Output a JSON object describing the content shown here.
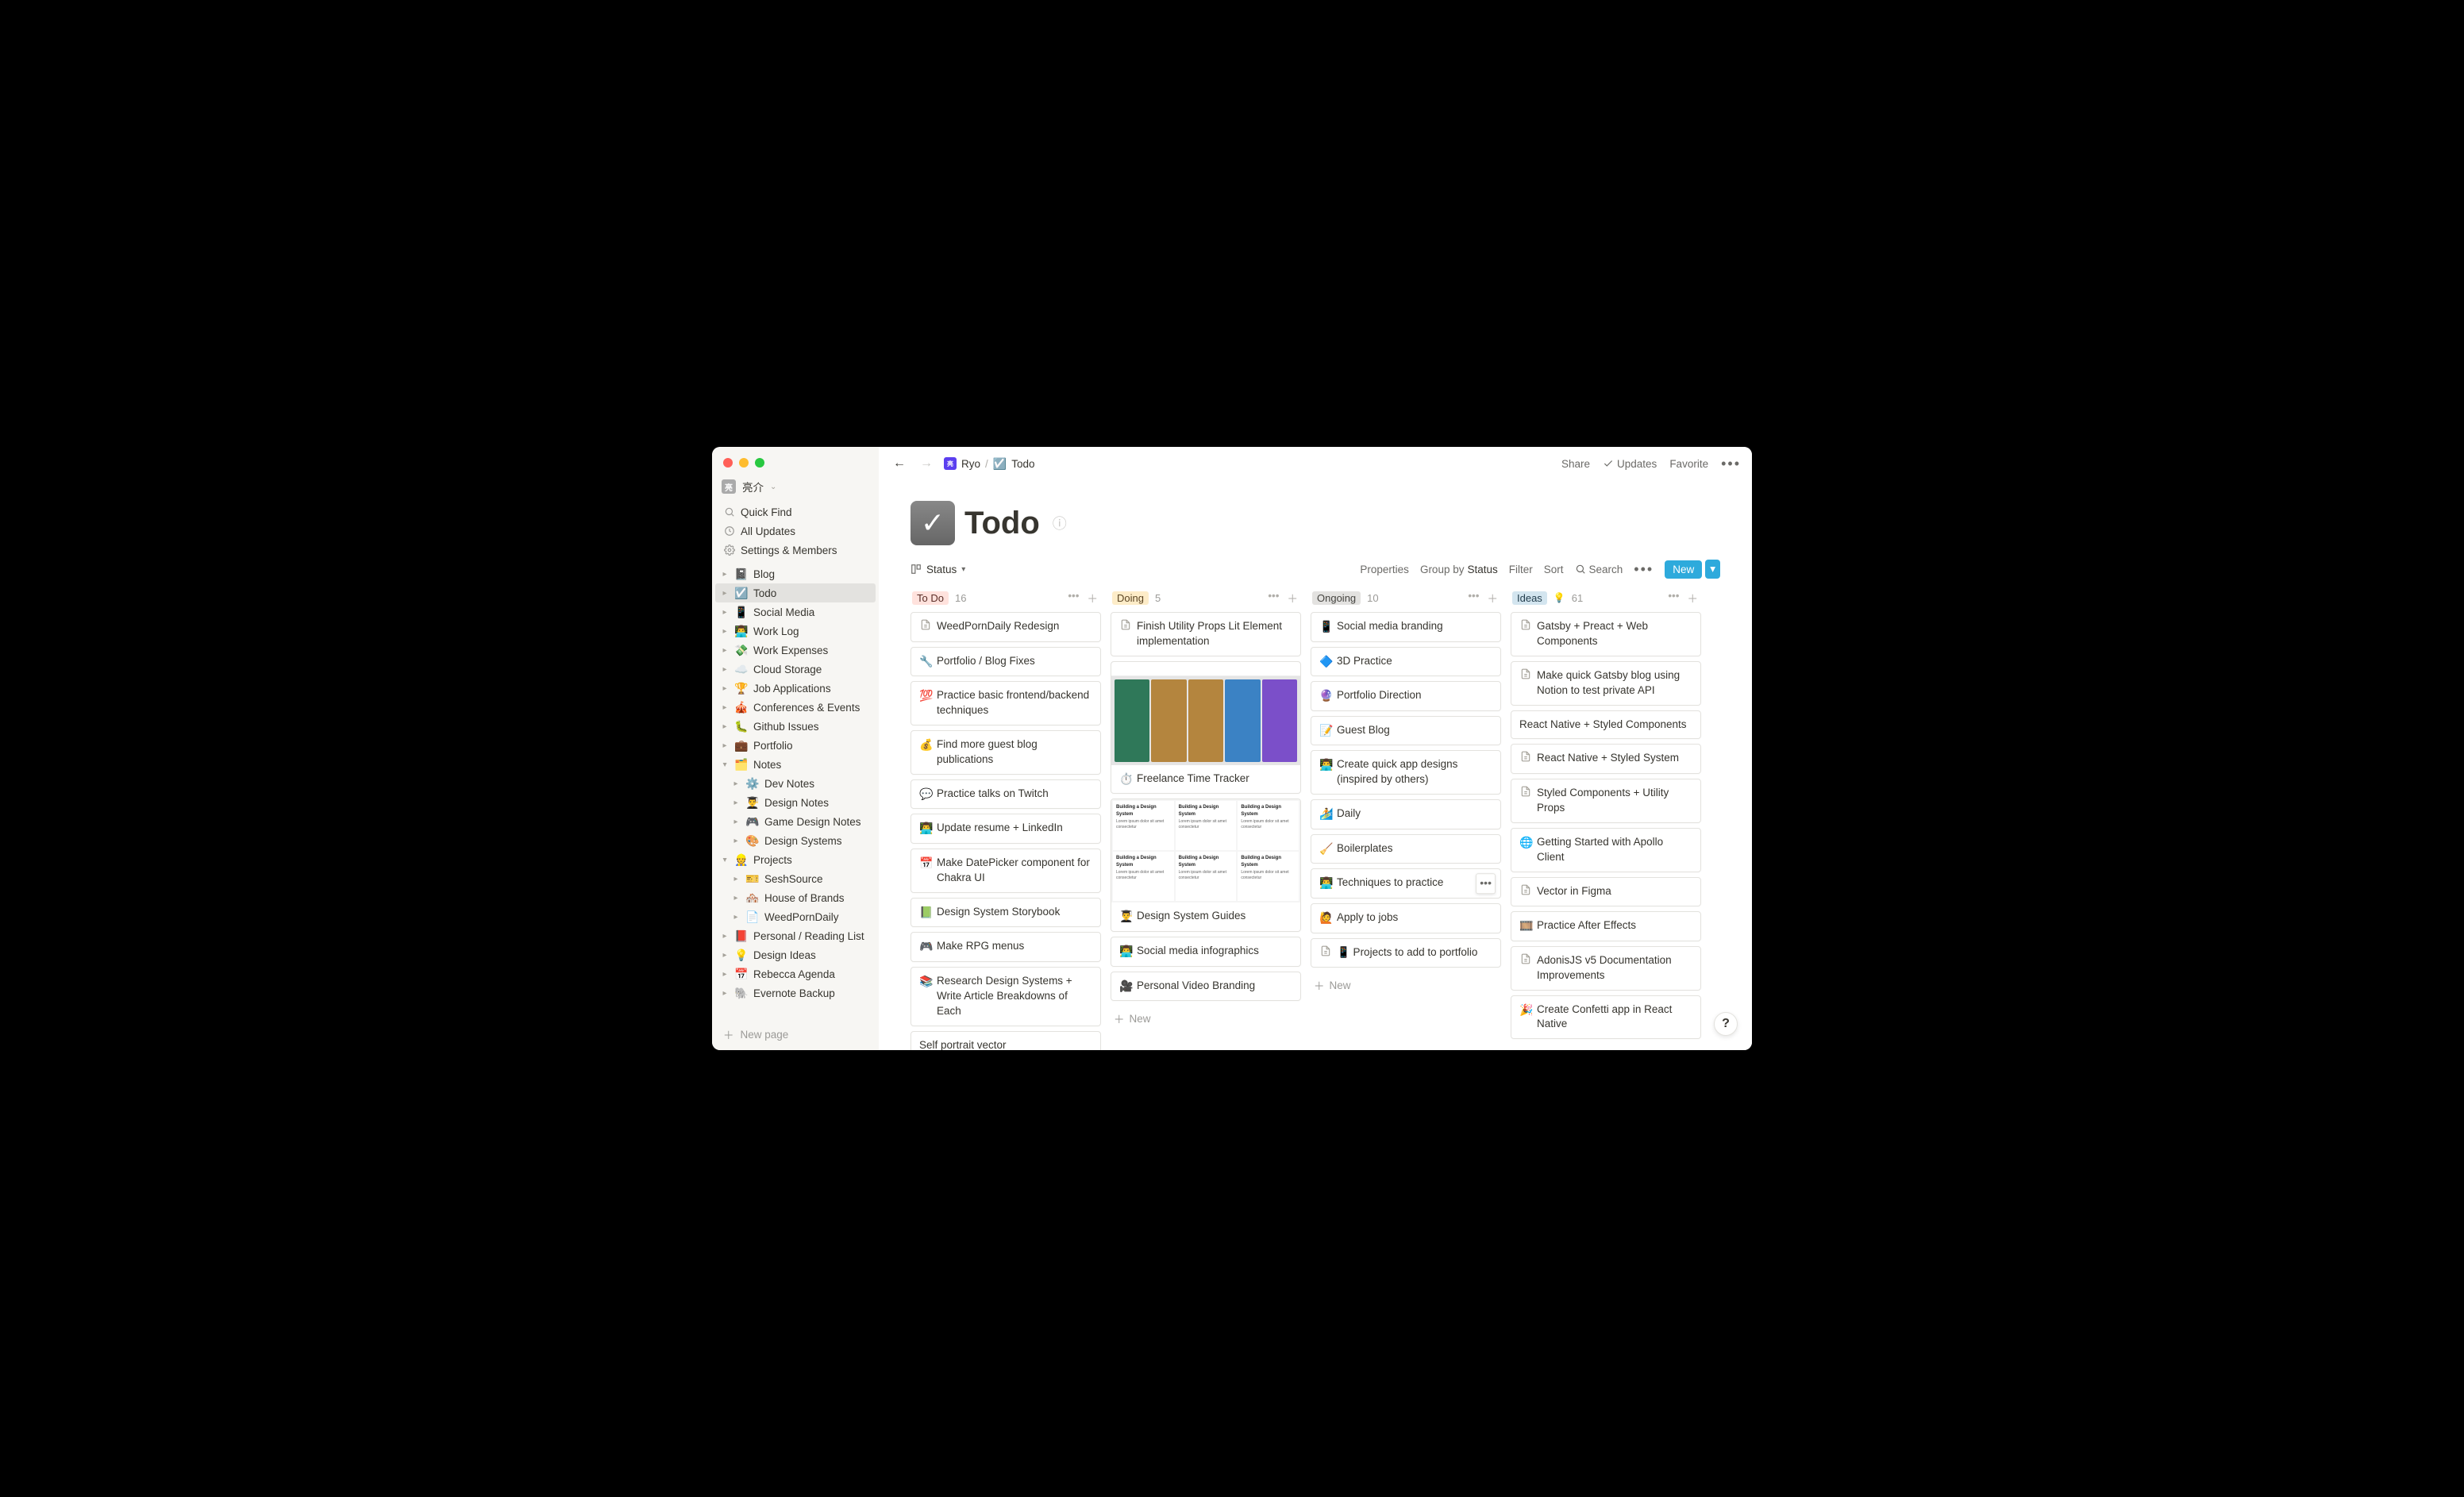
{
  "workspace": {
    "name": "亮介"
  },
  "sidebar_top": {
    "quick_find": "Quick Find",
    "all_updates": "All Updates",
    "settings": "Settings & Members"
  },
  "sidebar_tree": [
    {
      "emoji": "📓",
      "label": "Blog",
      "level": 0,
      "open": false
    },
    {
      "emoji": "☑️",
      "label": "Todo",
      "level": 0,
      "open": false,
      "active": true
    },
    {
      "emoji": "📱",
      "label": "Social Media",
      "level": 0,
      "open": false
    },
    {
      "emoji": "👨‍💻",
      "label": "Work Log",
      "level": 0,
      "open": false
    },
    {
      "emoji": "💸",
      "label": "Work Expenses",
      "level": 0,
      "open": false
    },
    {
      "emoji": "☁️",
      "label": "Cloud Storage",
      "level": 0,
      "open": false
    },
    {
      "emoji": "🏆",
      "label": "Job Applications",
      "level": 0,
      "open": false
    },
    {
      "emoji": "🎪",
      "label": "Conferences & Events",
      "level": 0,
      "open": false
    },
    {
      "emoji": "🐛",
      "label": "Github Issues",
      "level": 0,
      "open": false
    },
    {
      "emoji": "💼",
      "label": "Portfolio",
      "level": 0,
      "open": false
    },
    {
      "emoji": "🗂️",
      "label": "Notes",
      "level": 0,
      "open": true
    },
    {
      "emoji": "⚙️",
      "label": "Dev Notes",
      "level": 1,
      "open": false
    },
    {
      "emoji": "👨‍🎓",
      "label": "Design Notes",
      "level": 1,
      "open": false
    },
    {
      "emoji": "🎮",
      "label": "Game Design Notes",
      "level": 1,
      "open": false
    },
    {
      "emoji": "🎨",
      "label": "Design Systems",
      "level": 1,
      "open": false
    },
    {
      "emoji": "👷",
      "label": "Projects",
      "level": 0,
      "open": true
    },
    {
      "emoji": "🎫",
      "label": "SeshSource",
      "level": 1,
      "open": false
    },
    {
      "emoji": "🏘️",
      "label": "House of Brands",
      "level": 1,
      "open": false
    },
    {
      "emoji": "📄",
      "label": "WeedPornDaily",
      "level": 1,
      "open": false,
      "plain_icon": true
    },
    {
      "emoji": "📕",
      "label": "Personal / Reading List",
      "level": 0,
      "open": false
    },
    {
      "emoji": "💡",
      "label": "Design Ideas",
      "level": 0,
      "open": false
    },
    {
      "emoji": "📅",
      "label": "Rebecca Agenda",
      "level": 0,
      "open": false
    },
    {
      "emoji": "🐘",
      "label": "Evernote Backup",
      "level": 0,
      "open": false
    }
  ],
  "sidebar_new": "New page",
  "topbar": {
    "breadcrumb_workspace": "Ryo",
    "breadcrumb_page": "Todo",
    "share": "Share",
    "updates": "Updates",
    "favorite": "Favorite"
  },
  "page": {
    "title": "Todo",
    "view_label": "Status"
  },
  "controls": {
    "properties": "Properties",
    "groupby_prefix": "Group by ",
    "groupby_value": "Status",
    "filter": "Filter",
    "sort": "Sort",
    "search": "Search",
    "new": "New"
  },
  "columns": [
    {
      "id": "todo",
      "label": "To Do",
      "count": "16",
      "tag_class": "todo",
      "cards": [
        {
          "icon": "📄",
          "text": "WeedPornDaily Redesign",
          "page_icon": true
        },
        {
          "icon": "🔧",
          "text": "Portfolio / Blog Fixes"
        },
        {
          "icon": "💯",
          "text": "Practice basic frontend/backend techniques"
        },
        {
          "icon": "💰",
          "text": "Find more guest blog publications"
        },
        {
          "icon": "💬",
          "text": "Practice talks on Twitch"
        },
        {
          "icon": "👨‍💻",
          "text": "Update resume + LinkedIn"
        },
        {
          "icon": "📅",
          "text": "Make DatePicker component for Chakra UI"
        },
        {
          "icon": "📗",
          "text": "Design System Storybook"
        },
        {
          "icon": "🎮",
          "text": "Make RPG menus"
        },
        {
          "icon": "📚",
          "text": "Research Design Systems + Write Article Breakdowns of Each"
        },
        {
          "icon": "",
          "text": "Self portrait vector"
        }
      ]
    },
    {
      "id": "doing",
      "label": "Doing",
      "count": "5",
      "tag_class": "doing",
      "cards": [
        {
          "icon": "📄",
          "text": "Finish Utility Props Lit Element implementation",
          "page_icon": true
        },
        {
          "icon": "⏱️",
          "text": "Freelance Time Tracker",
          "cover": "calendar"
        },
        {
          "icon": "👨‍🎓",
          "text": "Design System Guides",
          "cover": "grid"
        },
        {
          "icon": "👨‍💻",
          "text": "Social media infographics"
        },
        {
          "icon": "🎥",
          "text": "Personal Video Branding"
        }
      ],
      "show_add": true
    },
    {
      "id": "ongoing",
      "label": "Ongoing",
      "count": "10",
      "tag_class": "ongoing",
      "cards": [
        {
          "icon": "📱",
          "text": "Social media branding"
        },
        {
          "icon": "🔷",
          "text": "3D Practice"
        },
        {
          "icon": "🔮",
          "text": "Portfolio Direction"
        },
        {
          "icon": "📝",
          "text": "Guest Blog"
        },
        {
          "icon": "👨‍💻",
          "text": "Create quick app designs (inspired by others)"
        },
        {
          "icon": "🏄",
          "text": "Daily"
        },
        {
          "icon": "🧹",
          "text": "Boilerplates"
        },
        {
          "icon": "👨‍💻",
          "text": "Techniques to practice",
          "hover_menu": true
        },
        {
          "icon": "🙋",
          "text": "Apply to jobs"
        },
        {
          "icon": "📄",
          "text": "📱 Projects to add to portfolio",
          "page_icon": true
        }
      ],
      "show_add": true
    },
    {
      "id": "ideas",
      "label": "Ideas",
      "count": "61",
      "tag_class": "ideas",
      "bulb": true,
      "cards": [
        {
          "icon": "📄",
          "text": "Gatsby + Preact + Web Components",
          "page_icon": true
        },
        {
          "icon": "📄",
          "text": "Make quick Gatsby blog using Notion to test private API",
          "page_icon": true
        },
        {
          "icon": "",
          "text": "React Native + Styled Components"
        },
        {
          "icon": "📄",
          "text": "React Native + Styled System",
          "page_icon": true
        },
        {
          "icon": "📄",
          "text": "Styled Components + Utility Props",
          "page_icon": true
        },
        {
          "icon": "🌐",
          "text": "Getting Started with Apollo Client"
        },
        {
          "icon": "📄",
          "text": "Vector in Figma",
          "page_icon": true
        },
        {
          "icon": "🎞️",
          "text": "Practice After Effects"
        },
        {
          "icon": "📄",
          "text": "AdonisJS v5 Documentation Improvements",
          "page_icon": true
        },
        {
          "icon": "🎉",
          "text": "Create Confetti app in React Native"
        }
      ]
    }
  ],
  "add_new_label": "New",
  "help": "?"
}
